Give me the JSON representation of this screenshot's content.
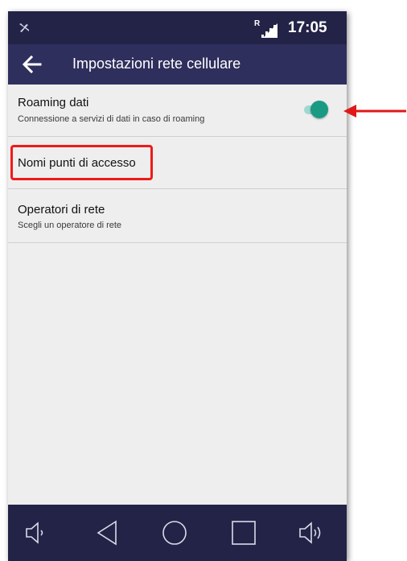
{
  "status_bar": {
    "roaming_indicator": "R",
    "time": "17:05",
    "icons": [
      "notification-icon",
      "signal-icon"
    ]
  },
  "app_bar": {
    "title": "Impostazioni rete cellulare",
    "back_icon": "arrow-left-icon"
  },
  "settings": [
    {
      "title": "Roaming dati",
      "subtitle": "Connessione a servizi di dati in caso di roaming",
      "toggle": "on"
    },
    {
      "title": "Nomi punti di accesso"
    },
    {
      "title": "Operatori di rete",
      "subtitle": "Scegli un operatore di rete"
    }
  ],
  "navigation_bar": {
    "buttons": [
      "volume-down-icon",
      "back-triangle-icon",
      "home-circle-icon",
      "recents-square-icon",
      "volume-up-icon"
    ]
  },
  "colors": {
    "status_bar": "#232347",
    "app_bar": "#2f2f5e",
    "background": "#eeeeee",
    "toggle_accent": "#1a9a83",
    "annotation": "#ee1b1b"
  }
}
